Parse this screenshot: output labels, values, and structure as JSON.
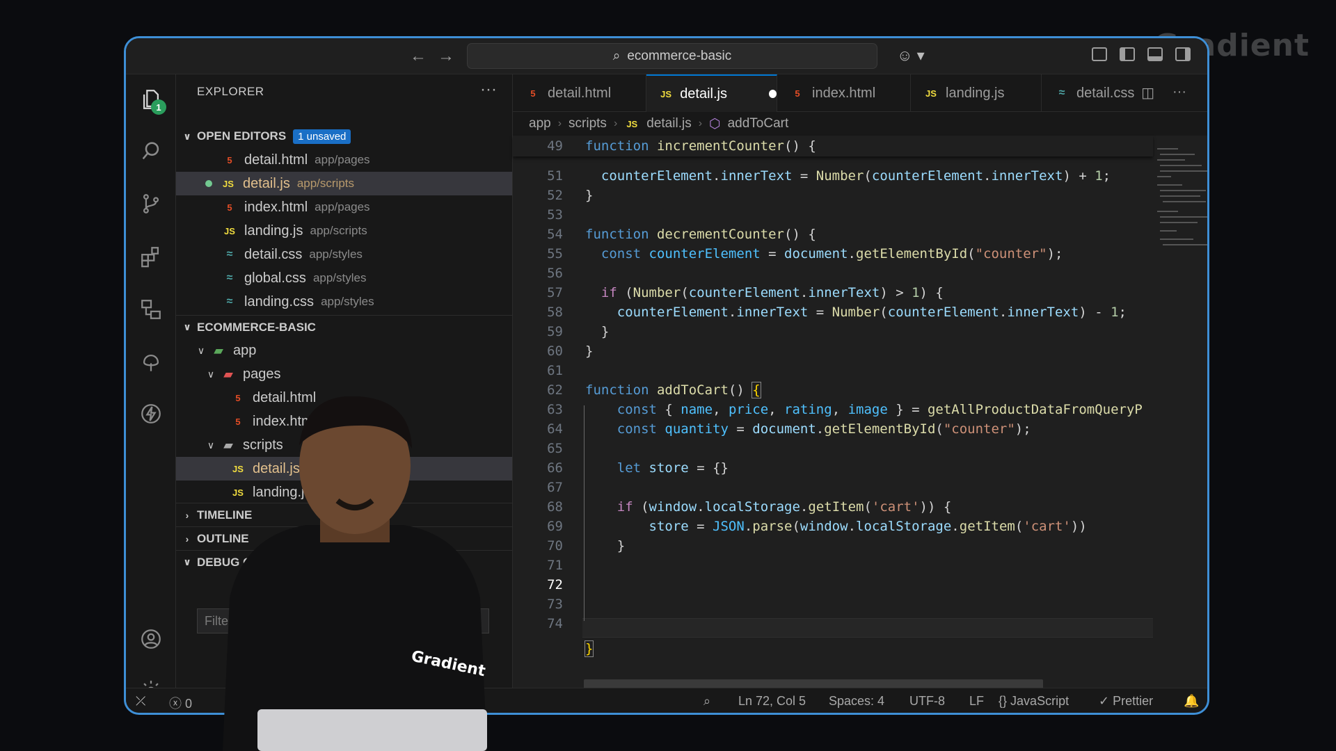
{
  "brand": "Gradient",
  "window": {
    "search_text": "ecommerce-basic"
  },
  "activity_bar": {
    "explorer_badge": "1"
  },
  "explorer": {
    "title": "EXPLORER",
    "more": "···",
    "open_editors": {
      "label": "OPEN EDITORS",
      "badge": "1 unsaved",
      "files": [
        {
          "name": "detail.html",
          "path": "app/pages",
          "icon": "html"
        },
        {
          "name": "detail.js",
          "path": "app/scripts",
          "icon": "js"
        },
        {
          "name": "index.html",
          "path": "app/pages",
          "icon": "html"
        },
        {
          "name": "landing.js",
          "path": "app/scripts",
          "icon": "js"
        },
        {
          "name": "detail.css",
          "path": "app/styles",
          "icon": "css"
        },
        {
          "name": "global.css",
          "path": "app/styles",
          "icon": "css"
        },
        {
          "name": "landing.css",
          "path": "app/styles",
          "icon": "css"
        }
      ]
    },
    "project": {
      "label": "ECOMMERCE-BASIC",
      "tree": [
        {
          "name": "app"
        },
        {
          "name": "pages"
        },
        {
          "name": "detail.html"
        },
        {
          "name": "index.html"
        },
        {
          "name": "scripts"
        },
        {
          "name": "detail.js"
        },
        {
          "name": "landing.js"
        }
      ]
    },
    "timeline": "TIMELINE",
    "outline": "OUTLINE",
    "debug_console": "DEBUG CONSOLE",
    "filter_placeholder": "Filter"
  },
  "tabs": [
    {
      "label": "detail.html",
      "icon": "html"
    },
    {
      "label": "detail.js",
      "icon": "js",
      "active": true,
      "dirty": true
    },
    {
      "label": "index.html",
      "icon": "html"
    },
    {
      "label": "landing.js",
      "icon": "js"
    },
    {
      "label": "detail.css",
      "icon": "css"
    }
  ],
  "breadcrumb": [
    "app",
    "scripts",
    "detail.js",
    "addToCart"
  ],
  "editor": {
    "sticky_line_number": "49",
    "line_numbers": [
      "51",
      "52",
      "53",
      "54",
      "55",
      "56",
      "57",
      "58",
      "59",
      "60",
      "61",
      "62",
      "63",
      "64",
      "65",
      "66",
      "67",
      "68",
      "69",
      "70",
      "71",
      "72",
      "73",
      "74"
    ],
    "current_line": "72"
  },
  "status": {
    "errors": "0",
    "cursor": "Ln 72, Col 5",
    "spaces": "Spaces: 4",
    "encoding": "UTF-8",
    "eol": "LF",
    "language": "JavaScript",
    "formatter": "Prettier"
  },
  "presenter_shirt_text": "Gradient",
  "colors": {
    "accent": "#0078d4",
    "window_border": "#3e8fd6",
    "editor_bg": "#1f1f1f"
  }
}
